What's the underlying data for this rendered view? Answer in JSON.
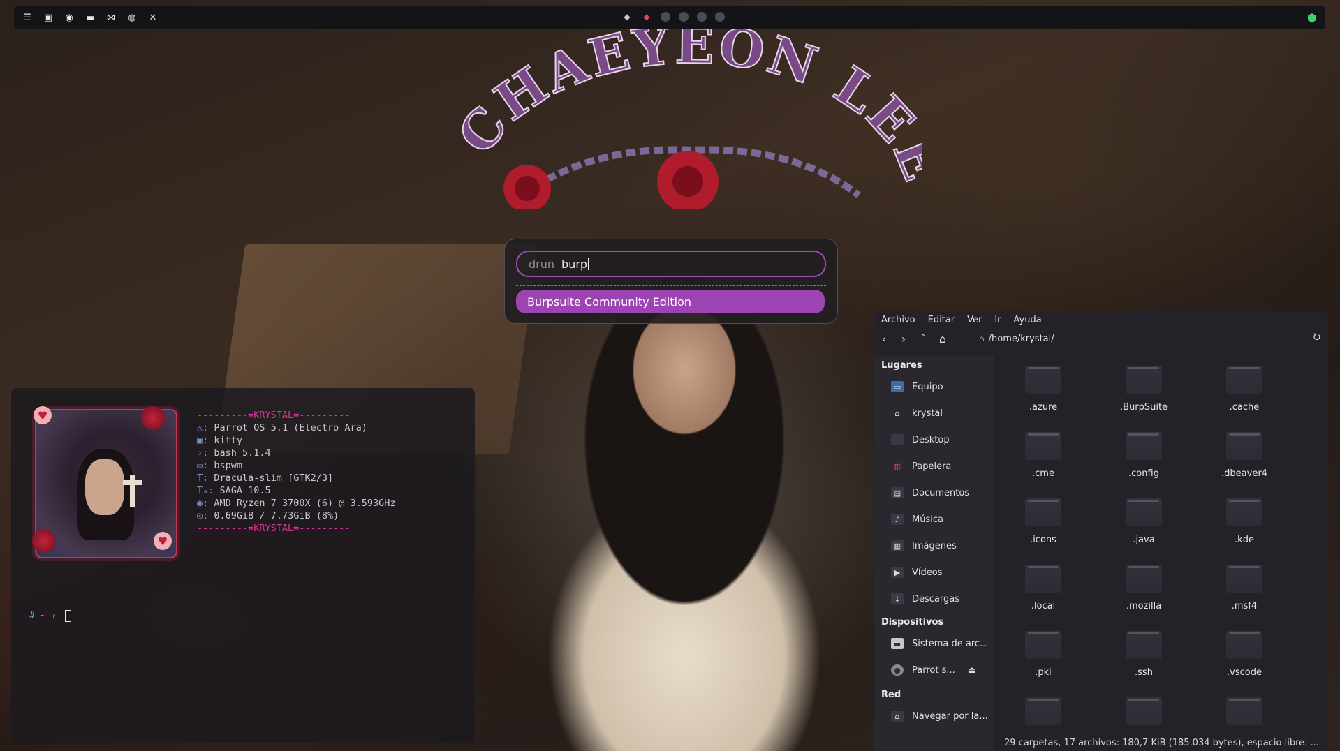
{
  "wallpaper": {
    "title_text": "CHAEYEON LEE"
  },
  "topbar": {
    "left_icons": [
      "menu-icon",
      "terminal-icon",
      "firefox-icon",
      "folder-icon",
      "vscode-icon",
      "discord-icon",
      "burpsuite-icon"
    ],
    "workspaces": [
      "gem-icon",
      "ruby-icon",
      "dot",
      "dot",
      "dot",
      "dot"
    ],
    "right_icon": "network-cube-icon"
  },
  "launcher": {
    "prompt": "drun",
    "query": "burp",
    "results": [
      "Burpsuite Community Edition"
    ]
  },
  "terminal": {
    "fetch_header": "---------=KRYSTAL=---------",
    "fetch_lines": [
      {
        "key": "△:",
        "value": "Parrot OS 5.1 (Electro Ara)"
      },
      {
        "key": "▣:",
        "value": "kitty"
      },
      {
        "key": "›:",
        "value": "bash 5.1.4"
      },
      {
        "key": "▭:",
        "value": "bspwm"
      },
      {
        "key": "T:",
        "value": "Dracula-slim [GTK2/3]"
      },
      {
        "key": "Tₐ:",
        "value": "SAGA 10.5"
      },
      {
        "key": "◉:",
        "value": "AMD Ryzen 7 3700X (6) @ 3.593GHz"
      },
      {
        "key": "◎:",
        "value": "0.69GiB / 7.73GiB (8%)"
      }
    ],
    "fetch_footer": "---------=KRYSTAL=---------",
    "prompt_dir": "~",
    "prompt_symbol": "›"
  },
  "file_manager": {
    "menu": [
      "Archivo",
      "Editar",
      "Ver",
      "Ir",
      "Ayuda"
    ],
    "path": "/home/krystal/",
    "sidebar": {
      "places_header": "Lugares",
      "places": [
        {
          "label": "Equipo",
          "icon": "computer-icon"
        },
        {
          "label": "krystal",
          "icon": "home-icon"
        },
        {
          "label": "Desktop",
          "icon": "desktop-icon"
        },
        {
          "label": "Papelera",
          "icon": "trash-icon"
        },
        {
          "label": "Documentos",
          "icon": "documents-icon"
        },
        {
          "label": "Música",
          "icon": "music-icon"
        },
        {
          "label": "Imágenes",
          "icon": "pictures-icon"
        },
        {
          "label": "Vídeos",
          "icon": "videos-icon"
        },
        {
          "label": "Descargas",
          "icon": "downloads-icon"
        }
      ],
      "devices_header": "Dispositivos",
      "devices": [
        {
          "label": "Sistema de arc...",
          "icon": "drive-icon"
        },
        {
          "label": "Parrot s...",
          "icon": "disc-icon"
        }
      ],
      "network_header": "Red",
      "network": [
        {
          "label": "Navegar por la...",
          "icon": "network-icon"
        }
      ]
    },
    "files": [
      ".azure",
      ".BurpSuite",
      ".cache",
      ".cme",
      ".config",
      ".dbeaver4",
      ".icons",
      ".java",
      ".kde",
      ".local",
      ".mozilla",
      ".msf4",
      ".pki",
      ".ssh",
      ".vscode",
      "",
      "",
      ""
    ],
    "status": "29 carpetas, 17 archivos: 180,7  KiB (185.034 bytes), espacio libre: ..."
  }
}
